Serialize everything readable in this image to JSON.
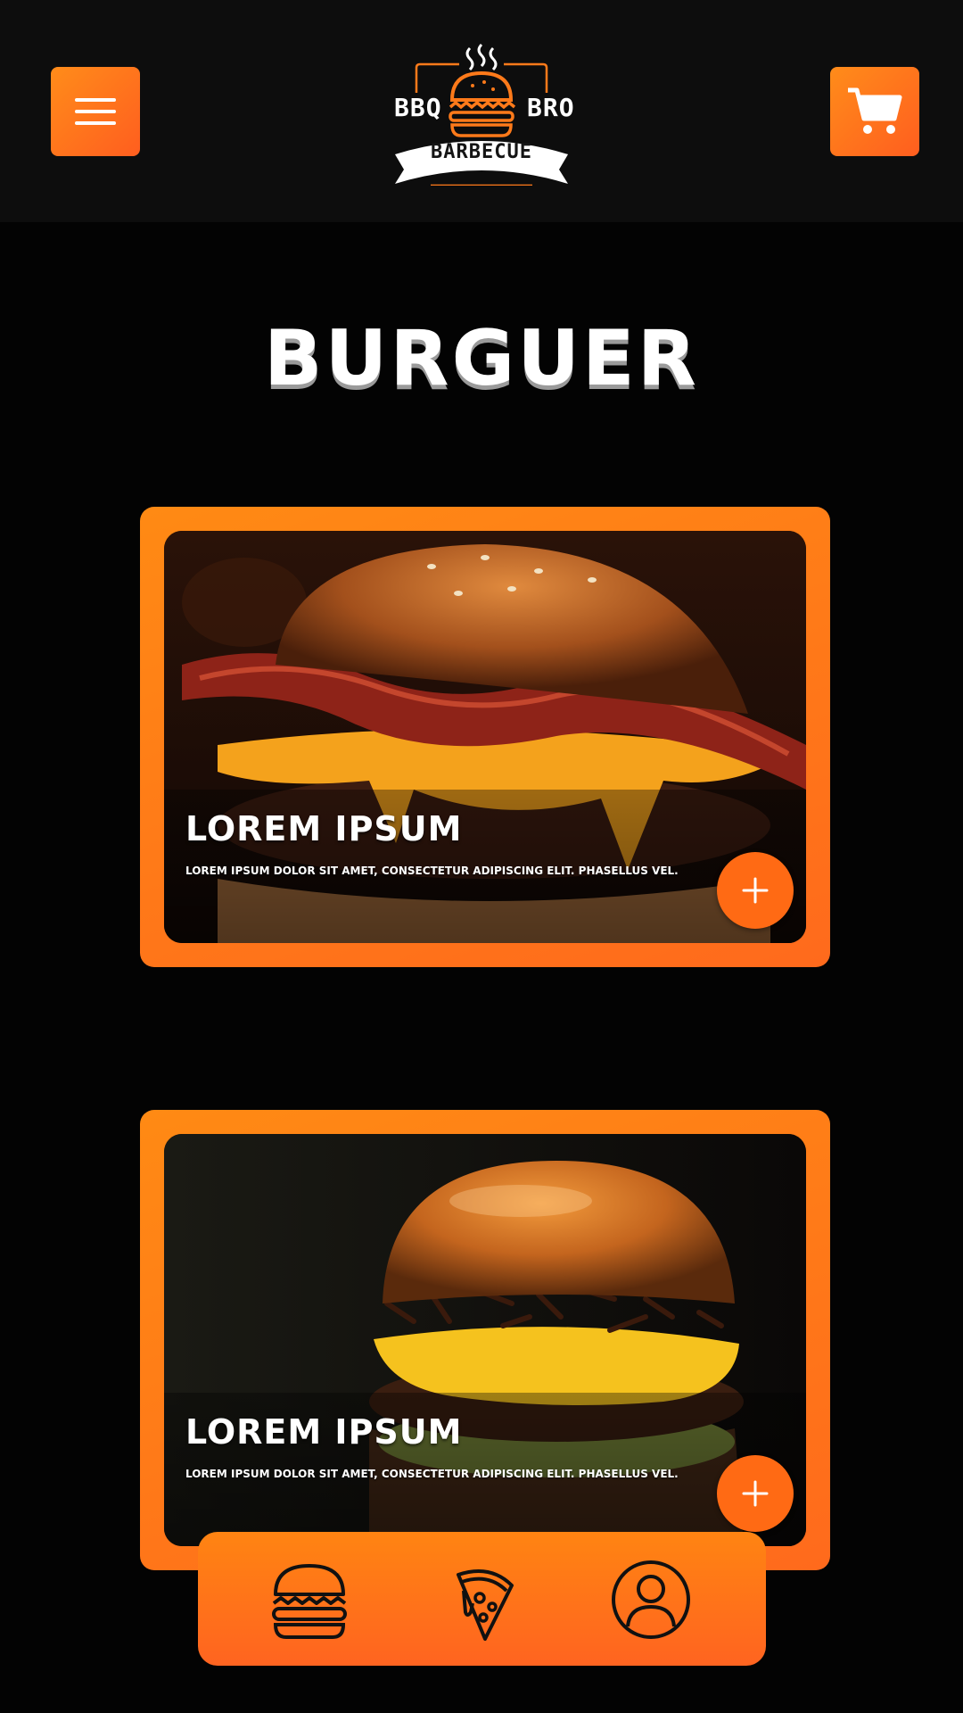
{
  "header": {
    "menu_icon": "hamburger-menu-icon",
    "cart_icon": "shopping-cart-icon",
    "logo": {
      "left_word": "BBQ",
      "right_word": "BRO",
      "ribbon": "BARBECUE"
    }
  },
  "page": {
    "title": "BURGUER"
  },
  "products": [
    {
      "title": "LOREM IPSUM",
      "description": "LOREM IPSUM DOLOR SIT AMET, CONSECTETUR ADIPISCING ELIT. PHASELLUS VEL.",
      "add_icon": "plus-icon"
    },
    {
      "title": "LOREM IPSUM",
      "description": "LOREM IPSUM DOLOR SIT AMET, CONSECTETUR ADIPISCING ELIT. PHASELLUS VEL.",
      "add_icon": "plus-icon"
    }
  ],
  "bottom_nav": {
    "items": [
      {
        "icon": "burger-icon"
      },
      {
        "icon": "pizza-icon"
      },
      {
        "icon": "user-profile-icon"
      }
    ]
  },
  "colors": {
    "accent": "#ff7a1a",
    "accent_dark": "#ff5e1f",
    "background": "#030303",
    "header_bg": "#0d0d0d"
  }
}
